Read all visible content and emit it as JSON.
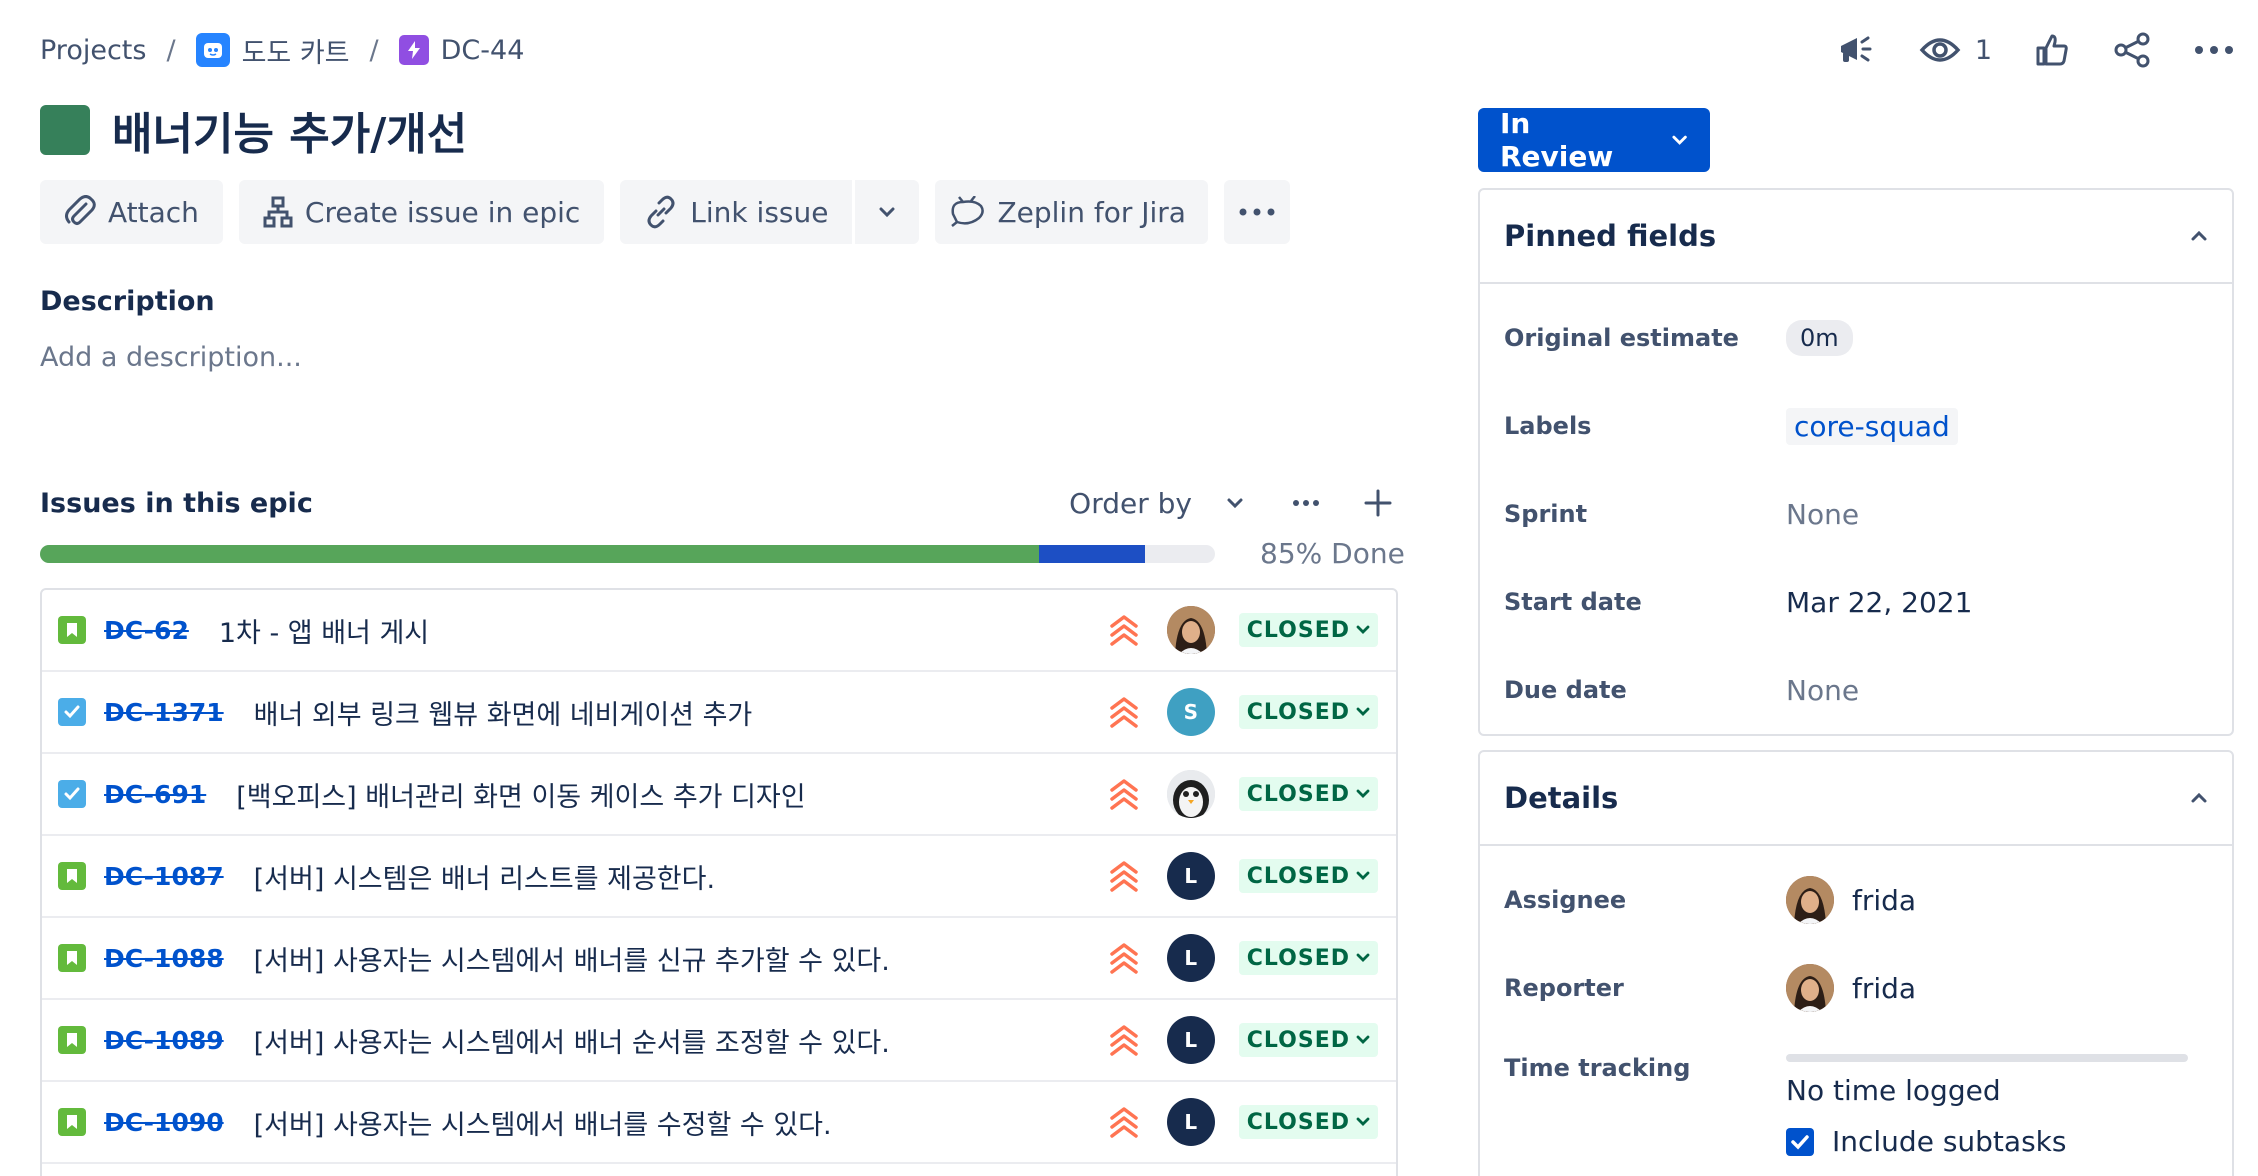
{
  "breadcrumb": {
    "projects": "Projects",
    "project_name": "도도 카트",
    "issue_key": "DC-44",
    "separator": "/"
  },
  "top_actions": {
    "watch_count": "1"
  },
  "issue": {
    "title": "배너기능 추가/개선",
    "epic_color": "#36805a"
  },
  "toolbar": {
    "attach": "Attach",
    "create_issue_in_epic": "Create issue in epic",
    "link_issue": "Link issue",
    "zeplin": "Zeplin for Jira"
  },
  "description": {
    "label": "Description",
    "placeholder": "Add a description..."
  },
  "epic_issues": {
    "label": "Issues in this epic",
    "order_by": "Order by",
    "progress_text": "85% Done",
    "progress": {
      "done_fraction": 0.85,
      "in_progress_fraction": 0.09
    },
    "items": [
      {
        "type": "story",
        "key": "DC-62",
        "summary": "1차 - 앱 배너 게시",
        "avatar": "photo",
        "avatar_letter": "",
        "status": "CLOSED"
      },
      {
        "type": "task",
        "key": "DC-1371",
        "summary": "배너 외부 링크 웹뷰 화면에 네비게이션 추가",
        "avatar": "s",
        "avatar_letter": "S",
        "status": "CLOSED"
      },
      {
        "type": "task",
        "key": "DC-691",
        "summary": "[백오피스] 배너관리 화면 이동 케이스 추가 디자인",
        "avatar": "peng",
        "avatar_letter": "",
        "status": "CLOSED"
      },
      {
        "type": "story",
        "key": "DC-1087",
        "summary": "[서버] 시스템은 배너 리스트를 제공한다.",
        "avatar": "l",
        "avatar_letter": "L",
        "status": "CLOSED"
      },
      {
        "type": "story",
        "key": "DC-1088",
        "summary": "[서버] 사용자는 시스템에서 배너를 신규 추가할 수 있다.",
        "avatar": "l",
        "avatar_letter": "L",
        "status": "CLOSED"
      },
      {
        "type": "story",
        "key": "DC-1089",
        "summary": "[서버] 사용자는 시스템에서 배너 순서를 조정할 수 있다.",
        "avatar": "l",
        "avatar_letter": "L",
        "status": "CLOSED"
      },
      {
        "type": "story",
        "key": "DC-1090",
        "summary": "[서버] 사용자는 시스템에서 배너를 수정할 수 있다.",
        "avatar": "l",
        "avatar_letter": "L",
        "status": "CLOSED"
      }
    ]
  },
  "status_button": {
    "label": "In Review"
  },
  "pinned_fields": {
    "title": "Pinned fields",
    "original_estimate": {
      "label": "Original estimate",
      "value": "0m"
    },
    "labels": {
      "label": "Labels",
      "value": "core-squad"
    },
    "sprint": {
      "label": "Sprint",
      "value": "None"
    },
    "start_date": {
      "label": "Start date",
      "value": "Mar 22, 2021"
    },
    "due_date": {
      "label": "Due date",
      "value": "None"
    }
  },
  "details": {
    "title": "Details",
    "assignee": {
      "label": "Assignee",
      "value": "frida"
    },
    "reporter": {
      "label": "Reporter",
      "value": "frida"
    },
    "time_tracking": {
      "label": "Time tracking",
      "value": "No time logged"
    },
    "include_subtasks": {
      "label": "Include subtasks",
      "checked": true
    }
  },
  "colors": {
    "primary": "#0052cc",
    "done": "#57a55a",
    "closed_bg": "#e3fcef",
    "closed_text": "#006644",
    "priority": "#ff7452"
  }
}
